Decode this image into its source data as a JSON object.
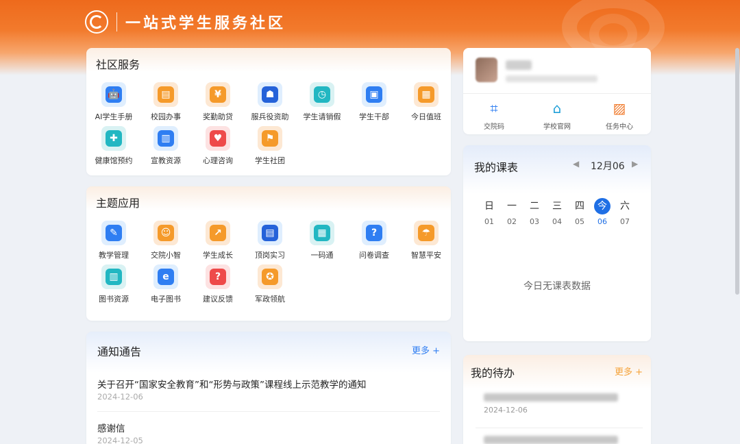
{
  "header": {
    "title": "一站式学生服务社区"
  },
  "community": {
    "title": "社区服务",
    "items": [
      {
        "label": "AI学生手册",
        "icon": "robot-icon",
        "glyph": "🤖"
      },
      {
        "label": "校园办事",
        "icon": "document-clock-icon",
        "glyph": "▤"
      },
      {
        "label": "奖勤助贷",
        "icon": "money-hand-icon",
        "glyph": "¥"
      },
      {
        "label": "服兵役资助",
        "icon": "soldier-icon",
        "glyph": "☗"
      },
      {
        "label": "学生请销假",
        "icon": "person-clock-icon",
        "glyph": "◷"
      },
      {
        "label": "学生干部",
        "icon": "id-card-icon",
        "glyph": "▣"
      },
      {
        "label": "今日值班",
        "icon": "calendar-icon",
        "glyph": "▦"
      },
      {
        "label": "健康馆预约",
        "icon": "medical-hands-icon",
        "glyph": "✚"
      },
      {
        "label": "宣教资源",
        "icon": "book-icon",
        "glyph": "▥"
      },
      {
        "label": "心理咨询",
        "icon": "heart-icon",
        "glyph": "♥"
      },
      {
        "label": "学生社团",
        "icon": "flag-icon",
        "glyph": "⚑"
      }
    ]
  },
  "themes": {
    "title": "主题应用",
    "items": [
      {
        "label": "教学管理",
        "icon": "teacher-icon",
        "glyph": "✎"
      },
      {
        "label": "交院小智",
        "icon": "robot-icon",
        "glyph": "☺"
      },
      {
        "label": "学生成长",
        "icon": "growth-chart-icon",
        "glyph": "↗"
      },
      {
        "label": "顶岗实习",
        "icon": "badge-icon",
        "glyph": "▤"
      },
      {
        "label": "一码通",
        "icon": "qr-code-icon",
        "glyph": "▦"
      },
      {
        "label": "问卷调查",
        "icon": "question-doc-icon",
        "glyph": "?"
      },
      {
        "label": "智慧平安",
        "icon": "umbrella-icon",
        "glyph": "☂"
      },
      {
        "label": "图书资源",
        "icon": "books-icon",
        "glyph": "▥"
      },
      {
        "label": "电子图书",
        "icon": "ebook-icon",
        "glyph": "e"
      },
      {
        "label": "建议反馈",
        "icon": "feedback-icon",
        "glyph": "?"
      },
      {
        "label": "军政领航",
        "icon": "military-emblem-icon",
        "glyph": "✪"
      }
    ]
  },
  "notices": {
    "title": "通知通告",
    "more": "更多 +",
    "items": [
      {
        "title": "关于召开“国家安全教育”和“形势与政策”课程线上示范教学的通知",
        "date": "2024-12-06"
      },
      {
        "title": "感谢信",
        "date": "2024-12-05"
      }
    ]
  },
  "profile": {
    "quick": [
      {
        "label": "交院码",
        "icon": "scan-code-icon",
        "glyph": "⌗"
      },
      {
        "label": "学校官网",
        "icon": "home-icon",
        "glyph": "⌂"
      },
      {
        "label": "任务中心",
        "icon": "clipboard-chart-icon",
        "glyph": "▨"
      }
    ]
  },
  "schedule": {
    "title": "我的课表",
    "date": "12月06",
    "days": [
      {
        "w": "日",
        "n": "01"
      },
      {
        "w": "一",
        "n": "02"
      },
      {
        "w": "二",
        "n": "03"
      },
      {
        "w": "三",
        "n": "04"
      },
      {
        "w": "四",
        "n": "05"
      },
      {
        "w": "今",
        "n": "06",
        "today": true
      },
      {
        "w": "六",
        "n": "07"
      }
    ],
    "empty": "今日无课表数据"
  },
  "todo": {
    "title": "我的待办",
    "more": "更多 +",
    "items": [
      {
        "date": "2024-12-06"
      }
    ]
  },
  "colors": {
    "brand": "#ee6a1c",
    "accent_blue": "#1f6fe5",
    "more_orange": "#f5a33a",
    "more_blue": "#2f7ef2"
  }
}
